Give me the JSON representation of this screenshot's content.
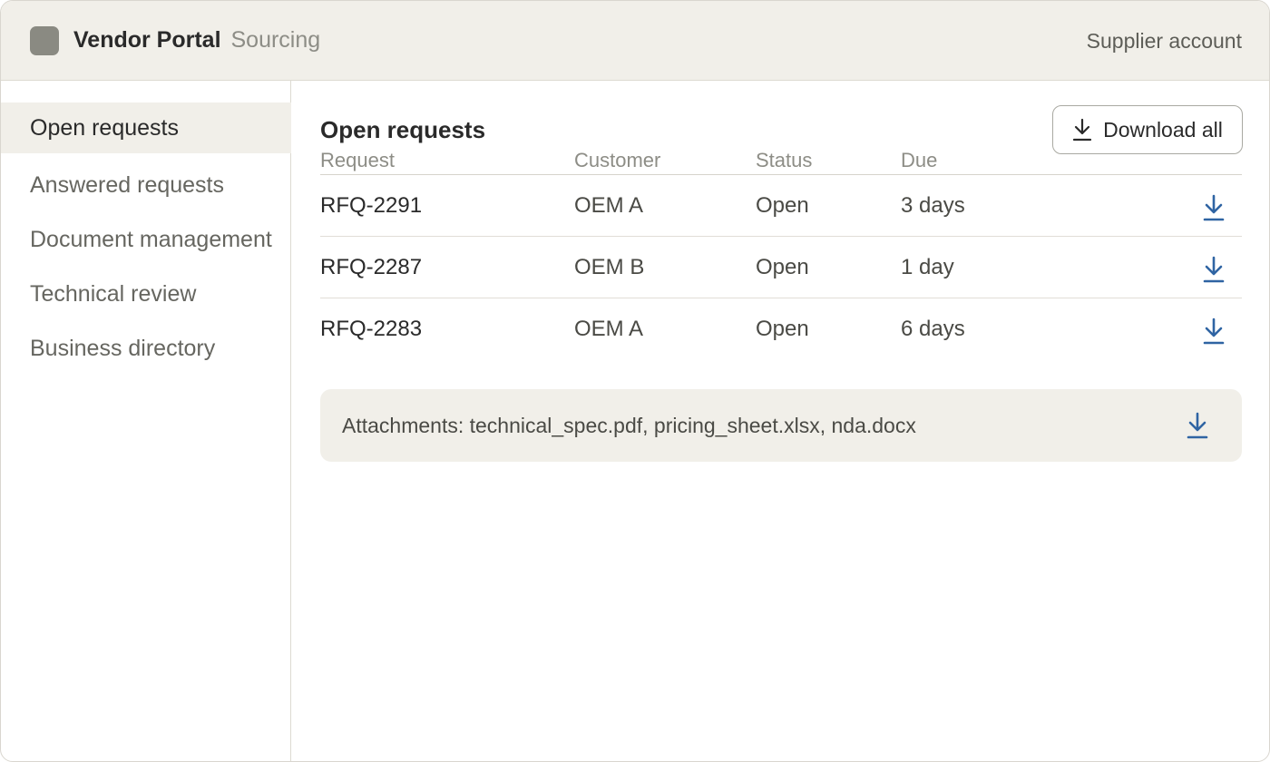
{
  "header": {
    "brand": "Vendor Portal",
    "brand_sub": "Sourcing",
    "account": "Supplier account"
  },
  "sidebar": {
    "items": [
      {
        "label": "Open requests",
        "active": true
      },
      {
        "label": "Answered requests"
      },
      {
        "label": "Document management"
      },
      {
        "label": "Technical review"
      },
      {
        "label": "Business directory"
      }
    ]
  },
  "main": {
    "title": "Open requests",
    "download_all_label": "Download all",
    "columns": [
      "Request",
      "Customer",
      "Status",
      "Due"
    ],
    "rows": [
      {
        "request": "RFQ-2291",
        "customer": "OEM A",
        "status": "Open",
        "due": "3 days"
      },
      {
        "request": "RFQ-2287",
        "customer": "OEM B",
        "status": "Open",
        "due": "1 day"
      },
      {
        "request": "RFQ-2283",
        "customer": "OEM A",
        "status": "Open",
        "due": "6 days"
      }
    ],
    "attachments": "Attachments: technical_spec.pdf, pricing_sheet.xlsx, nda.docx"
  },
  "colors": {
    "accent_blue": "#2f64a3",
    "header_bg": "#f1efe9"
  },
  "icons": {
    "logo": "logo-square-icon",
    "download": "download-icon"
  }
}
